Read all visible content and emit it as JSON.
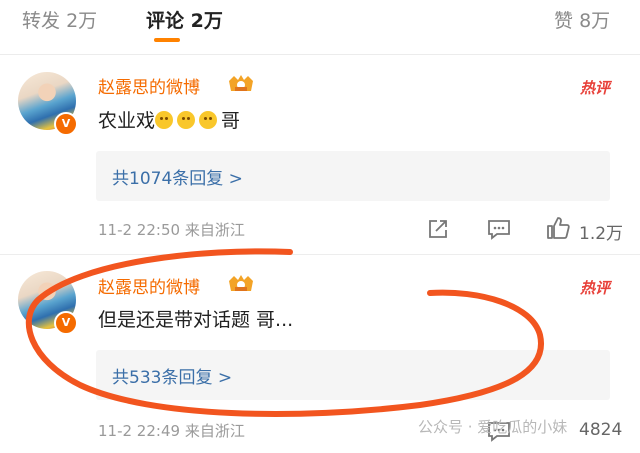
{
  "tabs": [
    {
      "label": "转发",
      "count": "2万"
    },
    {
      "label": "评论",
      "count": "2万"
    },
    {
      "label": "赞",
      "count": "8万"
    }
  ],
  "comments": [
    {
      "username": "赵露思的微博",
      "hot_badge": "热评",
      "content": "农业戏",
      "content_tail": "哥",
      "emoji_name": "sweat-smile-icon",
      "reply_count_label": "共1074条回复 >",
      "timestamp": "11-2 22:50",
      "source": "来自浙江",
      "likes": "1.2万"
    },
    {
      "username": "赵露思的微博",
      "hot_badge": "热评",
      "content": "但是还是带对话题 哥...",
      "reply_count_label": "共533条回复 >",
      "timestamp": "11-2 22:49",
      "source": "来自浙江",
      "likes": "4824"
    }
  ],
  "watermark": "公众号 · 爱吃瓜的小妹",
  "colors": {
    "accent": "#f56b00",
    "link": "#3b6fa8",
    "hot": "#e8413a",
    "annotation": "#f2551f"
  }
}
